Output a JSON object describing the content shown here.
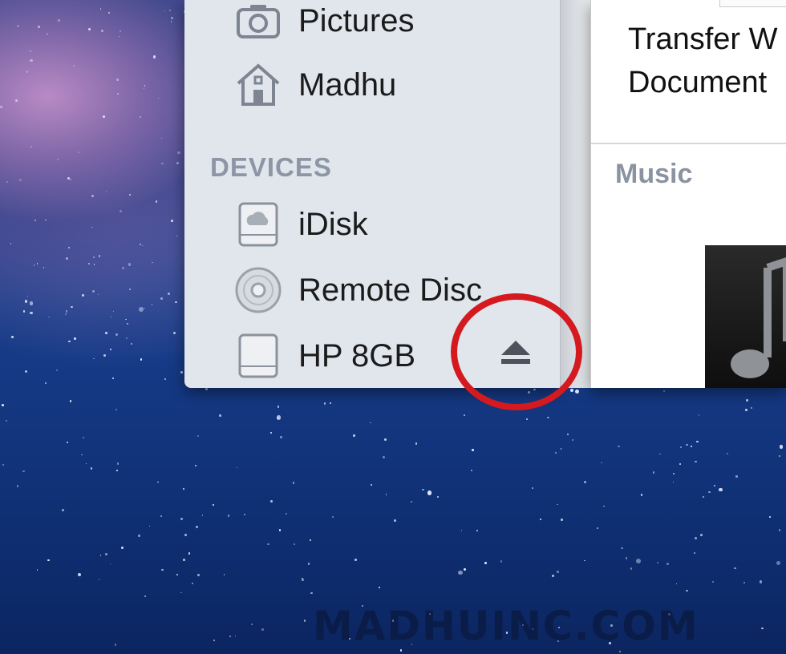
{
  "sidebar": {
    "items_top": [
      {
        "label": "Pictures",
        "icon": "camera-icon"
      },
      {
        "label": "Madhu",
        "icon": "home-icon"
      }
    ],
    "section_label": "DEVICES",
    "devices": [
      {
        "label": "iDisk",
        "icon": "idisk-icon"
      },
      {
        "label": "Remote Disc",
        "icon": "remote-disc-icon"
      },
      {
        "label": "HP 8GB",
        "icon": "external-drive-icon",
        "ejectable": true
      }
    ],
    "eject_icon": "eject-icon"
  },
  "content": {
    "document_lines": [
      "Transfer W",
      "Document"
    ],
    "music_header": "Music"
  },
  "watermark": "MADHUINC.COM",
  "colors": {
    "sidebar_bg": "#e1e6ed",
    "section_header": "#8d96a4",
    "highlight_circle": "#d41a1e",
    "desktop": "#163a86"
  }
}
